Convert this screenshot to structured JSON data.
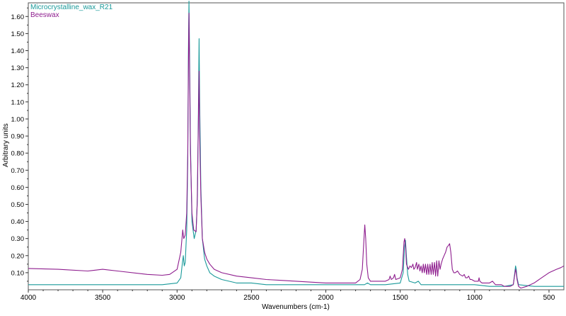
{
  "chart_data": {
    "type": "line",
    "xlabel": "Wavenumbers (cm-1)",
    "ylabel": "Arbitrary units",
    "xlim": [
      4000,
      400
    ],
    "ylim": [
      0,
      1.68
    ],
    "x_reversed": true,
    "x_ticks": [
      4000,
      3500,
      3000,
      2500,
      2000,
      1500,
      1000,
      500
    ],
    "x_tick_labels": [
      "4000",
      "3500",
      "3000",
      "2500",
      "2000",
      "1500",
      "1000",
      "500"
    ],
    "y_ticks": [
      0.1,
      0.2,
      0.3,
      0.4,
      0.5,
      0.6,
      0.7,
      0.8,
      0.9,
      1.0,
      1.1,
      1.2,
      1.3,
      1.4,
      1.5,
      1.6
    ],
    "y_tick_labels": [
      "0.10",
      "0.20",
      "0.30",
      "0.40",
      "0.50",
      "0.60",
      "0.70",
      "0.80",
      "0.90",
      "1.00",
      "1.10",
      "1.20",
      "1.30",
      "1.40",
      "1.50",
      "1.60"
    ],
    "grid": false,
    "legend_position": "top-left",
    "series": [
      {
        "name": "Microcrystalline_wax_R21",
        "color": "#1a9a9a",
        "points": [
          [
            4000,
            0.03
          ],
          [
            3700,
            0.03
          ],
          [
            3500,
            0.03
          ],
          [
            3300,
            0.03
          ],
          [
            3100,
            0.03
          ],
          [
            3000,
            0.04
          ],
          [
            2975,
            0.07
          ],
          [
            2965,
            0.15
          ],
          [
            2958,
            0.2
          ],
          [
            2952,
            0.14
          ],
          [
            2945,
            0.16
          ],
          [
            2935,
            0.35
          ],
          [
            2928,
            0.75
          ],
          [
            2924,
            1.4
          ],
          [
            2920,
            1.69
          ],
          [
            2916,
            1.4
          ],
          [
            2910,
            0.85
          ],
          [
            2900,
            0.4
          ],
          [
            2885,
            0.3
          ],
          [
            2872,
            0.35
          ],
          [
            2863,
            0.55
          ],
          [
            2857,
            1.0
          ],
          [
            2852,
            1.47
          ],
          [
            2848,
            1.1
          ],
          [
            2840,
            0.6
          ],
          [
            2830,
            0.3
          ],
          [
            2815,
            0.18
          ],
          [
            2800,
            0.14
          ],
          [
            2780,
            0.1
          ],
          [
            2750,
            0.08
          ],
          [
            2700,
            0.06
          ],
          [
            2600,
            0.04
          ],
          [
            2500,
            0.04
          ],
          [
            2400,
            0.03
          ],
          [
            2300,
            0.03
          ],
          [
            2200,
            0.03
          ],
          [
            2100,
            0.03
          ],
          [
            2000,
            0.03
          ],
          [
            1800,
            0.03
          ],
          [
            1740,
            0.03
          ],
          [
            1720,
            0.04
          ],
          [
            1700,
            0.03
          ],
          [
            1600,
            0.03
          ],
          [
            1500,
            0.04
          ],
          [
            1480,
            0.1
          ],
          [
            1472,
            0.24
          ],
          [
            1465,
            0.29
          ],
          [
            1460,
            0.22
          ],
          [
            1450,
            0.09
          ],
          [
            1440,
            0.05
          ],
          [
            1400,
            0.04
          ],
          [
            1378,
            0.05
          ],
          [
            1360,
            0.03
          ],
          [
            1300,
            0.03
          ],
          [
            1200,
            0.03
          ],
          [
            1100,
            0.03
          ],
          [
            1000,
            0.03
          ],
          [
            900,
            0.02
          ],
          [
            800,
            0.02
          ],
          [
            740,
            0.03
          ],
          [
            730,
            0.1
          ],
          [
            725,
            0.14
          ],
          [
            720,
            0.12
          ],
          [
            715,
            0.07
          ],
          [
            705,
            0.03
          ],
          [
            600,
            0.02
          ],
          [
            500,
            0.02
          ],
          [
            400,
            0.02
          ]
        ]
      },
      {
        "name": "Beeswax",
        "color": "#8e1d8e",
        "points": [
          [
            4000,
            0.125
          ],
          [
            3800,
            0.12
          ],
          [
            3600,
            0.11
          ],
          [
            3500,
            0.12
          ],
          [
            3400,
            0.11
          ],
          [
            3200,
            0.09
          ],
          [
            3100,
            0.085
          ],
          [
            3050,
            0.09
          ],
          [
            3000,
            0.12
          ],
          [
            2975,
            0.22
          ],
          [
            2962,
            0.35
          ],
          [
            2955,
            0.3
          ],
          [
            2945,
            0.32
          ],
          [
            2935,
            0.45
          ],
          [
            2928,
            0.8
          ],
          [
            2924,
            1.3
          ],
          [
            2920,
            1.62
          ],
          [
            2916,
            1.3
          ],
          [
            2910,
            0.8
          ],
          [
            2900,
            0.45
          ],
          [
            2888,
            0.35
          ],
          [
            2872,
            0.34
          ],
          [
            2865,
            0.5
          ],
          [
            2858,
            0.9
          ],
          [
            2852,
            1.28
          ],
          [
            2848,
            0.9
          ],
          [
            2840,
            0.55
          ],
          [
            2830,
            0.3
          ],
          [
            2815,
            0.22
          ],
          [
            2800,
            0.18
          ],
          [
            2780,
            0.15
          ],
          [
            2750,
            0.12
          ],
          [
            2700,
            0.1
          ],
          [
            2600,
            0.08
          ],
          [
            2500,
            0.07
          ],
          [
            2400,
            0.06
          ],
          [
            2300,
            0.055
          ],
          [
            2200,
            0.05
          ],
          [
            2100,
            0.045
          ],
          [
            2000,
            0.04
          ],
          [
            1900,
            0.04
          ],
          [
            1800,
            0.04
          ],
          [
            1770,
            0.06
          ],
          [
            1755,
            0.12
          ],
          [
            1745,
            0.28
          ],
          [
            1738,
            0.38
          ],
          [
            1732,
            0.3
          ],
          [
            1725,
            0.15
          ],
          [
            1715,
            0.07
          ],
          [
            1700,
            0.05
          ],
          [
            1650,
            0.05
          ],
          [
            1600,
            0.05
          ],
          [
            1575,
            0.06
          ],
          [
            1568,
            0.08
          ],
          [
            1560,
            0.06
          ],
          [
            1545,
            0.07
          ],
          [
            1538,
            0.09
          ],
          [
            1530,
            0.06
          ],
          [
            1500,
            0.07
          ],
          [
            1485,
            0.12
          ],
          [
            1475,
            0.28
          ],
          [
            1470,
            0.3
          ],
          [
            1464,
            0.25
          ],
          [
            1458,
            0.15
          ],
          [
            1445,
            0.12
          ],
          [
            1435,
            0.14
          ],
          [
            1425,
            0.13
          ],
          [
            1415,
            0.15
          ],
          [
            1408,
            0.12
          ],
          [
            1400,
            0.13
          ],
          [
            1390,
            0.16
          ],
          [
            1385,
            0.12
          ],
          [
            1375,
            0.15
          ],
          [
            1368,
            0.11
          ],
          [
            1360,
            0.14
          ],
          [
            1352,
            0.1
          ],
          [
            1345,
            0.15
          ],
          [
            1338,
            0.1
          ],
          [
            1330,
            0.15
          ],
          [
            1322,
            0.09
          ],
          [
            1315,
            0.15
          ],
          [
            1308,
            0.09
          ],
          [
            1300,
            0.15
          ],
          [
            1292,
            0.09
          ],
          [
            1285,
            0.16
          ],
          [
            1278,
            0.09
          ],
          [
            1270,
            0.16
          ],
          [
            1262,
            0.08
          ],
          [
            1255,
            0.17
          ],
          [
            1248,
            0.08
          ],
          [
            1240,
            0.17
          ],
          [
            1232,
            0.12
          ],
          [
            1225,
            0.15
          ],
          [
            1215,
            0.18
          ],
          [
            1205,
            0.2
          ],
          [
            1195,
            0.22
          ],
          [
            1185,
            0.25
          ],
          [
            1175,
            0.26
          ],
          [
            1168,
            0.27
          ],
          [
            1160,
            0.22
          ],
          [
            1150,
            0.12
          ],
          [
            1140,
            0.1
          ],
          [
            1130,
            0.1
          ],
          [
            1115,
            0.11
          ],
          [
            1100,
            0.09
          ],
          [
            1080,
            0.08
          ],
          [
            1070,
            0.09
          ],
          [
            1060,
            0.07
          ],
          [
            1050,
            0.07
          ],
          [
            1040,
            0.08
          ],
          [
            1030,
            0.06
          ],
          [
            1020,
            0.06
          ],
          [
            1000,
            0.05
          ],
          [
            975,
            0.05
          ],
          [
            970,
            0.07
          ],
          [
            965,
            0.05
          ],
          [
            950,
            0.04
          ],
          [
            900,
            0.04
          ],
          [
            880,
            0.05
          ],
          [
            860,
            0.03
          ],
          [
            820,
            0.03
          ],
          [
            800,
            0.02
          ],
          [
            760,
            0.02
          ],
          [
            740,
            0.03
          ],
          [
            730,
            0.09
          ],
          [
            725,
            0.12
          ],
          [
            720,
            0.1
          ],
          [
            715,
            0.06
          ],
          [
            705,
            0.02
          ],
          [
            690,
            0.01
          ],
          [
            650,
            0.02
          ],
          [
            600,
            0.04
          ],
          [
            550,
            0.07
          ],
          [
            500,
            0.1
          ],
          [
            450,
            0.12
          ],
          [
            420,
            0.13
          ],
          [
            400,
            0.14
          ]
        ]
      }
    ]
  }
}
